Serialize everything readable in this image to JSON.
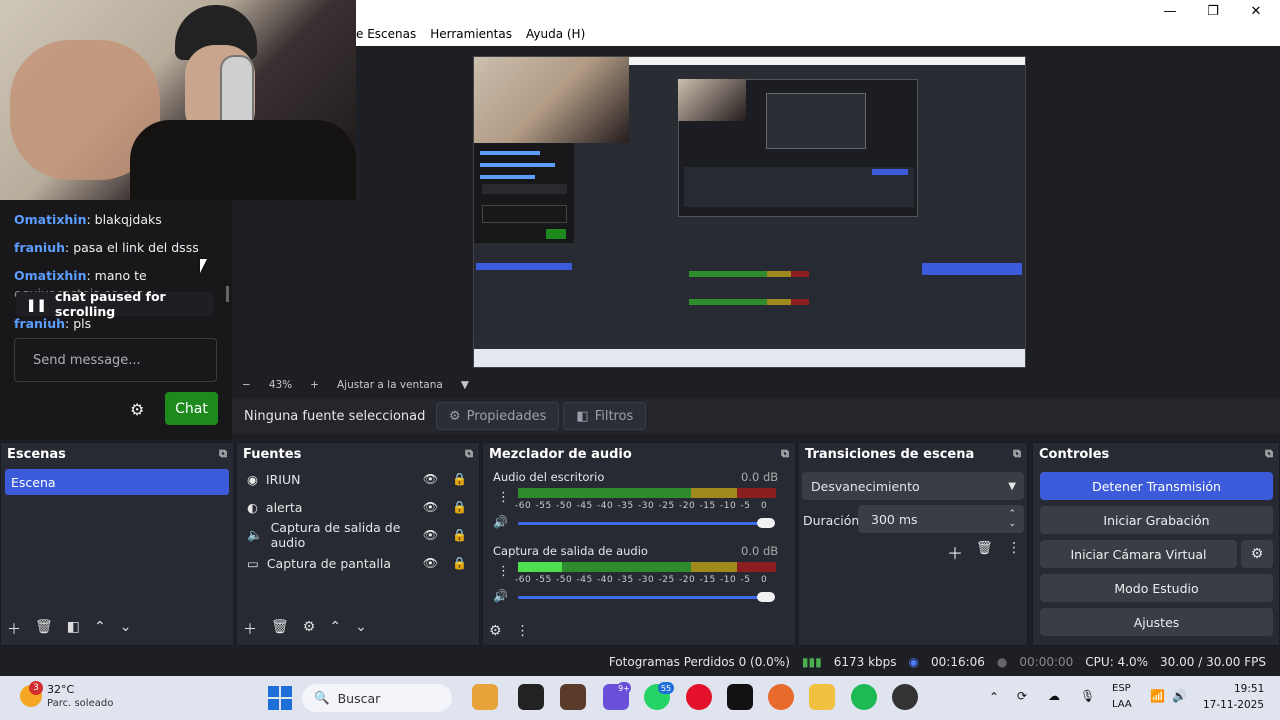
{
  "window": {
    "menu": [
      "e Escenas",
      "Herramientas",
      "Ayuda (H)"
    ],
    "controls": {
      "minimize": "—",
      "maximize": "❐",
      "close": "✕"
    }
  },
  "chat": {
    "messages": [
      {
        "user": "Omatixhin",
        "text": ": blakqjdaks"
      },
      {
        "user": "franiuh",
        "text": ": pasa el link del dsss"
      },
      {
        "user": "Omatixhin",
        "text": ": mano te"
      },
      {
        "user": "",
        "text": "equivocasteis es con x"
      },
      {
        "user": "franiuh",
        "text": ": pls"
      }
    ],
    "paused_label": "chat paused for scrolling",
    "placeholder": "Send message...",
    "chat_button": "Chat"
  },
  "zoom": {
    "minus": "−",
    "value": "43%",
    "plus": "+",
    "fit": "Ajustar a la ventana"
  },
  "sourcebar": {
    "selected": "Ninguna fuente seleccionad",
    "properties": "Propiedades",
    "filters": "Filtros"
  },
  "scenes": {
    "title": "Escenas",
    "items": [
      "Escena"
    ]
  },
  "sources": {
    "title": "Fuentes",
    "items": [
      {
        "label": "IRIUN",
        "icon": "camera-icon"
      },
      {
        "label": "alerta",
        "icon": "browser-icon"
      },
      {
        "label": "Captura de salida de audio",
        "icon": "speaker-icon"
      },
      {
        "label": "Captura de pantalla",
        "icon": "monitor-icon"
      }
    ]
  },
  "mixer": {
    "title": "Mezclador de audio",
    "channels": [
      {
        "name": "Audio del escritorio",
        "db": "0.0 dB",
        "level": 0.0
      },
      {
        "name": "Captura de salida de audio",
        "db": "0.0 dB",
        "level": 0.17
      }
    ],
    "ticks": [
      "-60",
      "-55",
      "-50",
      "-45",
      "-40",
      "-35",
      "-30",
      "-25",
      "-20",
      "-15",
      "-10",
      "-5",
      "0"
    ]
  },
  "transitions": {
    "title": "Transiciones de escena",
    "type": "Desvanecimiento",
    "duration_label": "Duración",
    "duration_value": "300 ms"
  },
  "controls": {
    "title": "Controles",
    "buttons": [
      "Detener Transmisión",
      "Iniciar Grabación",
      "Iniciar Cámara Virtual",
      "Modo Estudio",
      "Ajustes"
    ]
  },
  "status": {
    "frames": "Fotogramas Perdidos 0 (0.0%)",
    "bitrate": "6173 kbps",
    "stream_time": "00:16:06",
    "rec_time": "00:00:00",
    "cpu": "CPU: 4.0%",
    "fps": "30.00 / 30.00 FPS"
  },
  "taskbar": {
    "weather_temp": "32°C",
    "weather_desc": "Parc. soleado",
    "weather_badge": "3",
    "search": "Buscar",
    "lang1": "ESP",
    "lang2": "LAA",
    "time": "19:51",
    "date": "17-11-2025",
    "messenger_badge": "9+",
    "whatsapp_badge": "55"
  },
  "colors": {
    "accent": "#3b5bdb",
    "chat_green": "#1e8a1e",
    "meter_green": "#2e8b2e",
    "meter_yellow": "#a08a1e",
    "meter_red": "#8b1e1e",
    "username": "#5c9dff"
  }
}
